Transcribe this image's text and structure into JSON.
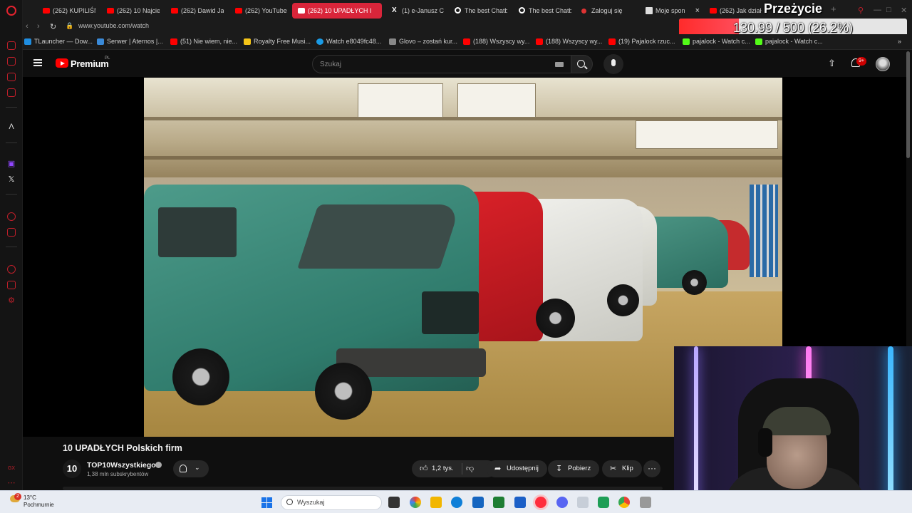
{
  "overlay": {
    "title": "Przeżycie",
    "progress_text": "130.99 / 500 (26.2%)",
    "progress_fraction": 0.262
  },
  "tabs": [
    {
      "label": "(262) KUPILIŚM",
      "icon": "youtube-icon"
    },
    {
      "label": "(262) 10 Najcie",
      "icon": "youtube-icon"
    },
    {
      "label": "(262) Dawid Ja",
      "icon": "youtube-icon"
    },
    {
      "label": "(262) YouTube",
      "icon": "youtube-icon"
    },
    {
      "label": "(262) 10 UPADŁYCH I",
      "icon": "youtube-icon"
    },
    {
      "label": "(1) e-Janusz C",
      "icon": "x-icon"
    },
    {
      "label": "The best Chatb",
      "icon": "chat-icon"
    },
    {
      "label": "The best Chatb",
      "icon": "chat-icon"
    },
    {
      "label": "Zaloguj się",
      "icon": "login-icon"
    },
    {
      "label": "Moje spon",
      "icon": "page-icon"
    },
    {
      "label": "(262) Jak dział",
      "icon": "youtube-icon"
    }
  ],
  "tab_close": "×",
  "tab_new": "+",
  "address": {
    "url": "www.youtube.com/watch"
  },
  "bookmarks": [
    {
      "label": "TLauncher — Dow...",
      "color": "#1f8de0"
    },
    {
      "label": "Serwer | Aternos |...",
      "color": "#3a8ad8"
    },
    {
      "label": "(51) Nie wiem, nie...",
      "color": "#ff0000"
    },
    {
      "label": "Royalty Free Musi...",
      "color": "#f5c518"
    },
    {
      "label": "Watch e8049fc48...",
      "color": "#1a9be6"
    },
    {
      "label": "Glovo – zostań kur...",
      "color": "#888888"
    },
    {
      "label": "(188) Wszyscy wy...",
      "color": "#ff0000"
    },
    {
      "label": "(188) Wszyscy wy...",
      "color": "#ff0000"
    },
    {
      "label": "(19) Pajalock rzuc...",
      "color": "#ff0000"
    },
    {
      "label": "pajalock - Watch c...",
      "color": "#53fc18"
    },
    {
      "label": "pajalock - Watch c...",
      "color": "#53fc18"
    }
  ],
  "youtube": {
    "brand": "Premium",
    "country": "PL",
    "search_placeholder": "Szukaj",
    "notifications": "9+"
  },
  "video": {
    "title": "10 UPADŁYCH Polskich firm",
    "channel_initials": "10",
    "channel_name": "TOP10Wszystkiego",
    "subscribers": "1,38 mln subskrybentów",
    "likes": "1,2 tys.",
    "share_label": "Udostępnij",
    "download_label": "Pobierz",
    "clip_label": "Klip",
    "more_label": "···"
  },
  "taskbar": {
    "weather_temp": "13°C",
    "weather_desc": "Pochmurnie",
    "weather_badge": "2",
    "search_label": "Wyszukaj"
  },
  "colors": {
    "accent": "#ff0000",
    "tab_active": "#d9253a",
    "opera": "#e4232f"
  }
}
